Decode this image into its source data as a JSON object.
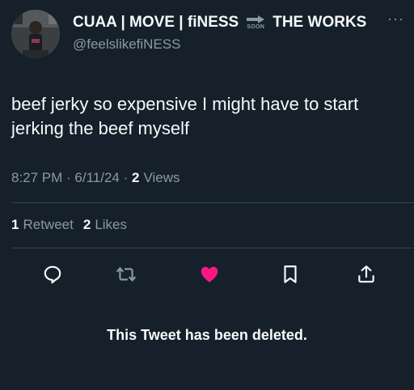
{
  "author": {
    "display_name_part1": "CUAA | MOVE | fiNESS",
    "arrow_label": "SOON",
    "display_name_part2": "THE WORKS",
    "handle": "@feelslikefiNESS",
    "avatar_icon": "profile-photo",
    "more_icon": "more-options-icon"
  },
  "tweet": {
    "text_line1": "beef jerky so expensive I might have to start",
    "text_line2": "jerking the beef myself",
    "time": "8:27 PM",
    "date": "6/11/24",
    "views_count": "2",
    "views_label": "Views",
    "retweets_count": "1",
    "retweets_label": "Retweet",
    "likes_count": "2",
    "likes_label": "Likes"
  },
  "actions": {
    "reply_icon": "reply-icon",
    "retweet_icon": "retweet-icon",
    "like_icon": "heart-icon",
    "bookmark_icon": "bookmark-icon",
    "share_icon": "share-icon"
  },
  "deleted_notice": "This Tweet has been deleted.",
  "colors": {
    "background": "#15202b",
    "text_primary": "#f7f9f9",
    "text_secondary": "#8b98a5",
    "divider": "#38444d",
    "like_active": "#f91880"
  }
}
